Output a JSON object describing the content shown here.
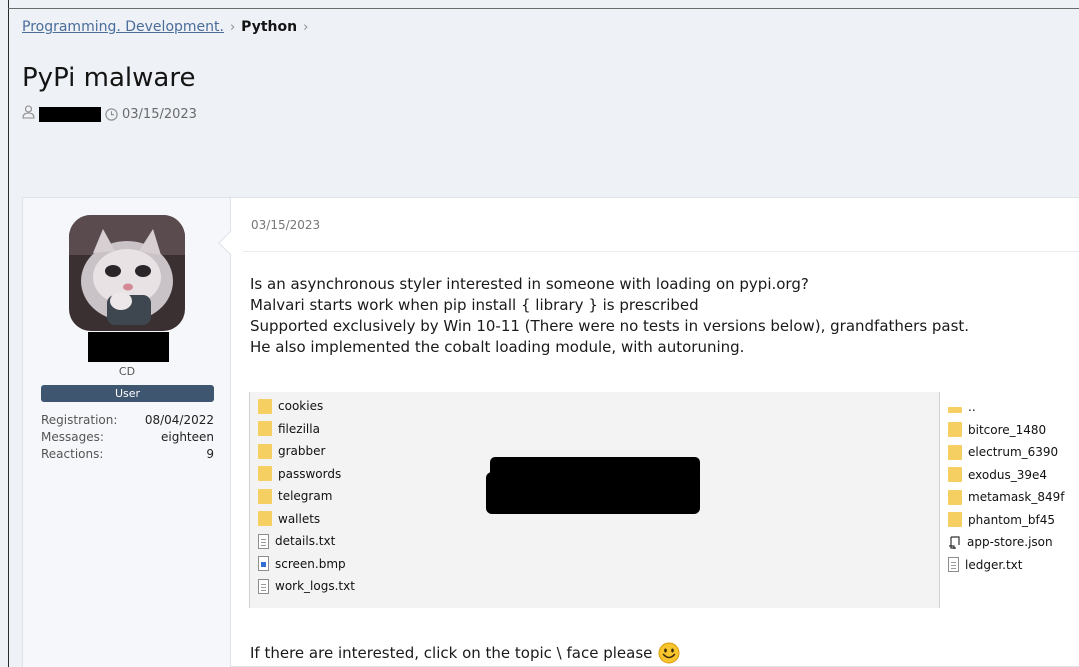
{
  "breadcrumb": {
    "items": [
      "Programming. Development.",
      "Python"
    ],
    "separator": "›"
  },
  "thread": {
    "title": "PyPi malware",
    "date": "03/15/2023"
  },
  "author": {
    "user_title": "CD",
    "badge": "User",
    "stats": [
      {
        "label": "Registration:",
        "value": "08/04/2022"
      },
      {
        "label": "Messages:",
        "value": "eighteen"
      },
      {
        "label": "Reactions:",
        "value": "9"
      }
    ]
  },
  "post": {
    "date": "03/15/2023",
    "lines": [
      "Is an asynchronous styler interested in someone with loading on pypi.org?",
      "Malvari starts work when pip install { library } is prescribed",
      "Supported exclusively by Win 10-11 (There were no tests in versions below), grandfathers past.",
      "He also implemented the cobalt loading module, with autoruning."
    ],
    "footer": "If there are interested, click on the topic \\ face please"
  },
  "screenshot": {
    "left_files": [
      {
        "name": "cookies",
        "icon": "folder-icon"
      },
      {
        "name": "filezilla",
        "icon": "folder-icon"
      },
      {
        "name": "grabber",
        "icon": "folder-icon"
      },
      {
        "name": "passwords",
        "icon": "folder-icon"
      },
      {
        "name": "telegram",
        "icon": "folder-icon"
      },
      {
        "name": "wallets",
        "icon": "folder-icon"
      },
      {
        "name": "details.txt",
        "icon": "text-file-icon"
      },
      {
        "name": "screen.bmp",
        "icon": "image-file-icon"
      },
      {
        "name": "work_logs.txt",
        "icon": "text-file-icon"
      }
    ],
    "right_files": [
      {
        "name": "..",
        "icon": "parent-folder-icon"
      },
      {
        "name": "bitcore_1480",
        "icon": "folder-icon"
      },
      {
        "name": "electrum_6390",
        "icon": "folder-icon"
      },
      {
        "name": "exodus_39e4",
        "icon": "folder-icon"
      },
      {
        "name": "metamask_849f",
        "icon": "folder-icon"
      },
      {
        "name": "phantom_bf45",
        "icon": "folder-icon"
      },
      {
        "name": "app-store.json",
        "icon": "json-file-icon"
      },
      {
        "name": "ledger.txt",
        "icon": "text-file-icon"
      }
    ]
  },
  "colors": {
    "page_bg": "#eef1f6",
    "link": "#4a6d9a",
    "badge_bg": "#3f5670",
    "folder": "#f6cf62"
  }
}
